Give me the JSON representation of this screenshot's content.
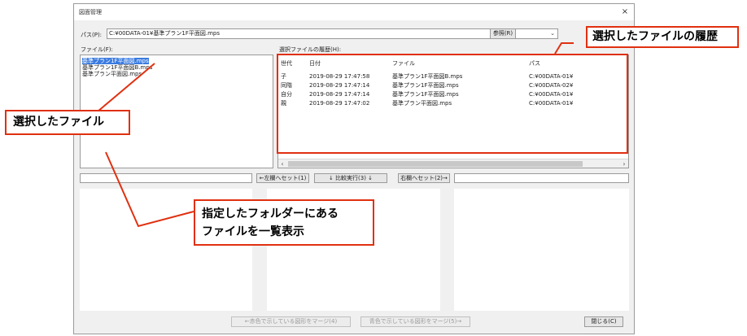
{
  "window": {
    "title": "図面管理",
    "close_label": "×"
  },
  "path": {
    "label": "パス(P):",
    "value": "C:¥00DATA-01¥基準プラン1F平面図.mps",
    "browse_button": "参照(R)"
  },
  "file_list": {
    "label": "ファイル(F):",
    "items": [
      "基準プラン1F平面図.mps",
      "基準プラン1F平面図B.mps",
      "基準プラン平面図.mps"
    ],
    "selected_index": 0
  },
  "history": {
    "label": "選択ファイルの履歴(H):",
    "columns": [
      "世代",
      "日付",
      "ファイル",
      "パス"
    ],
    "rows": [
      {
        "gen": "子",
        "date": "2019-08-29 17:47:58",
        "file": "基準プラン1F平面図B.mps",
        "path": "C:¥00DATA-01¥"
      },
      {
        "gen": "同階",
        "date": "2019-08-29 17:47:14",
        "file": "基準プラン1F平面図.mps",
        "path": "C:¥00DATA-02¥"
      },
      {
        "gen": "自分",
        "date": "2019-08-29 17:47:14",
        "file": "基準プラン1F平面図.mps",
        "path": "C:¥00DATA-01¥"
      },
      {
        "gen": "親",
        "date": "2019-08-29 17:47:02",
        "file": "基準プラン平面図.mps",
        "path": "C:¥00DATA-01¥"
      }
    ]
  },
  "compare": {
    "left_set": "←左欄へセット(1)",
    "run": "↓ 比較実行(3) ↓",
    "right_set": "右欄へセット(2)→"
  },
  "bottom": {
    "merge_red": "←赤色で示している図形をマージ(4)",
    "merge_blue": "青色で示している図形をマージ(5)→",
    "close": "閉じる(C)"
  },
  "annotations": {
    "history": "選択したファイルの履歴",
    "selected": "選択したファイル",
    "folder_line1": "指定したフォルダーにある",
    "folder_line2": "ファイルを一覧表示"
  },
  "colors": {
    "callout_border": "#e03010",
    "selection": "#3a7be0"
  }
}
